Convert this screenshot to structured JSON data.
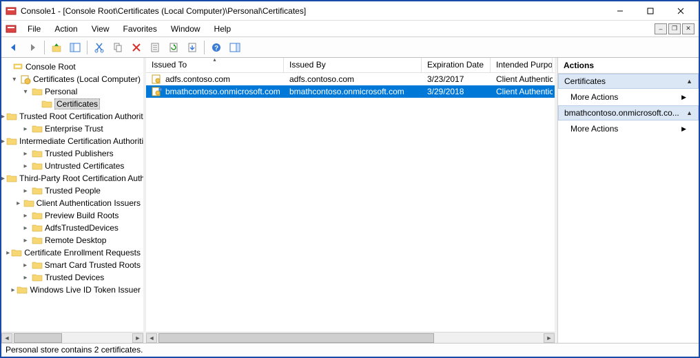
{
  "title": "Console1 - [Console Root\\Certificates (Local Computer)\\Personal\\Certificates]",
  "menu": [
    "File",
    "Action",
    "View",
    "Favorites",
    "Window",
    "Help"
  ],
  "tree": {
    "root": "Console Root",
    "snapin": "Certificates (Local Computer)",
    "personal": "Personal",
    "selected": "Certificates",
    "stores": [
      "Trusted Root Certification Authorities",
      "Enterprise Trust",
      "Intermediate Certification Authorities",
      "Trusted Publishers",
      "Untrusted Certificates",
      "Third-Party Root Certification Authorities",
      "Trusted People",
      "Client Authentication Issuers",
      "Preview Build Roots",
      "AdfsTrustedDevices",
      "Remote Desktop",
      "Certificate Enrollment Requests",
      "Smart Card Trusted Roots",
      "Trusted Devices",
      "Windows Live ID Token Issuer"
    ]
  },
  "list": {
    "columns": [
      "Issued To",
      "Issued By",
      "Expiration Date",
      "Intended Purposes"
    ],
    "rows": [
      {
        "issuedTo": "adfs.contoso.com",
        "issuedBy": "adfs.contoso.com",
        "expires": "3/23/2017",
        "purpose": "Client Authentication",
        "selected": false
      },
      {
        "issuedTo": "bmathcontoso.onmicrosoft.com",
        "issuedBy": "bmathcontoso.onmicrosoft.com",
        "expires": "3/29/2018",
        "purpose": "Client Authentication",
        "selected": true
      }
    ]
  },
  "actions": {
    "title": "Actions",
    "section1": "Certificates",
    "more": "More Actions",
    "section2": "bmathcontoso.onmicrosoft.co..."
  },
  "status": "Personal store contains 2 certificates."
}
